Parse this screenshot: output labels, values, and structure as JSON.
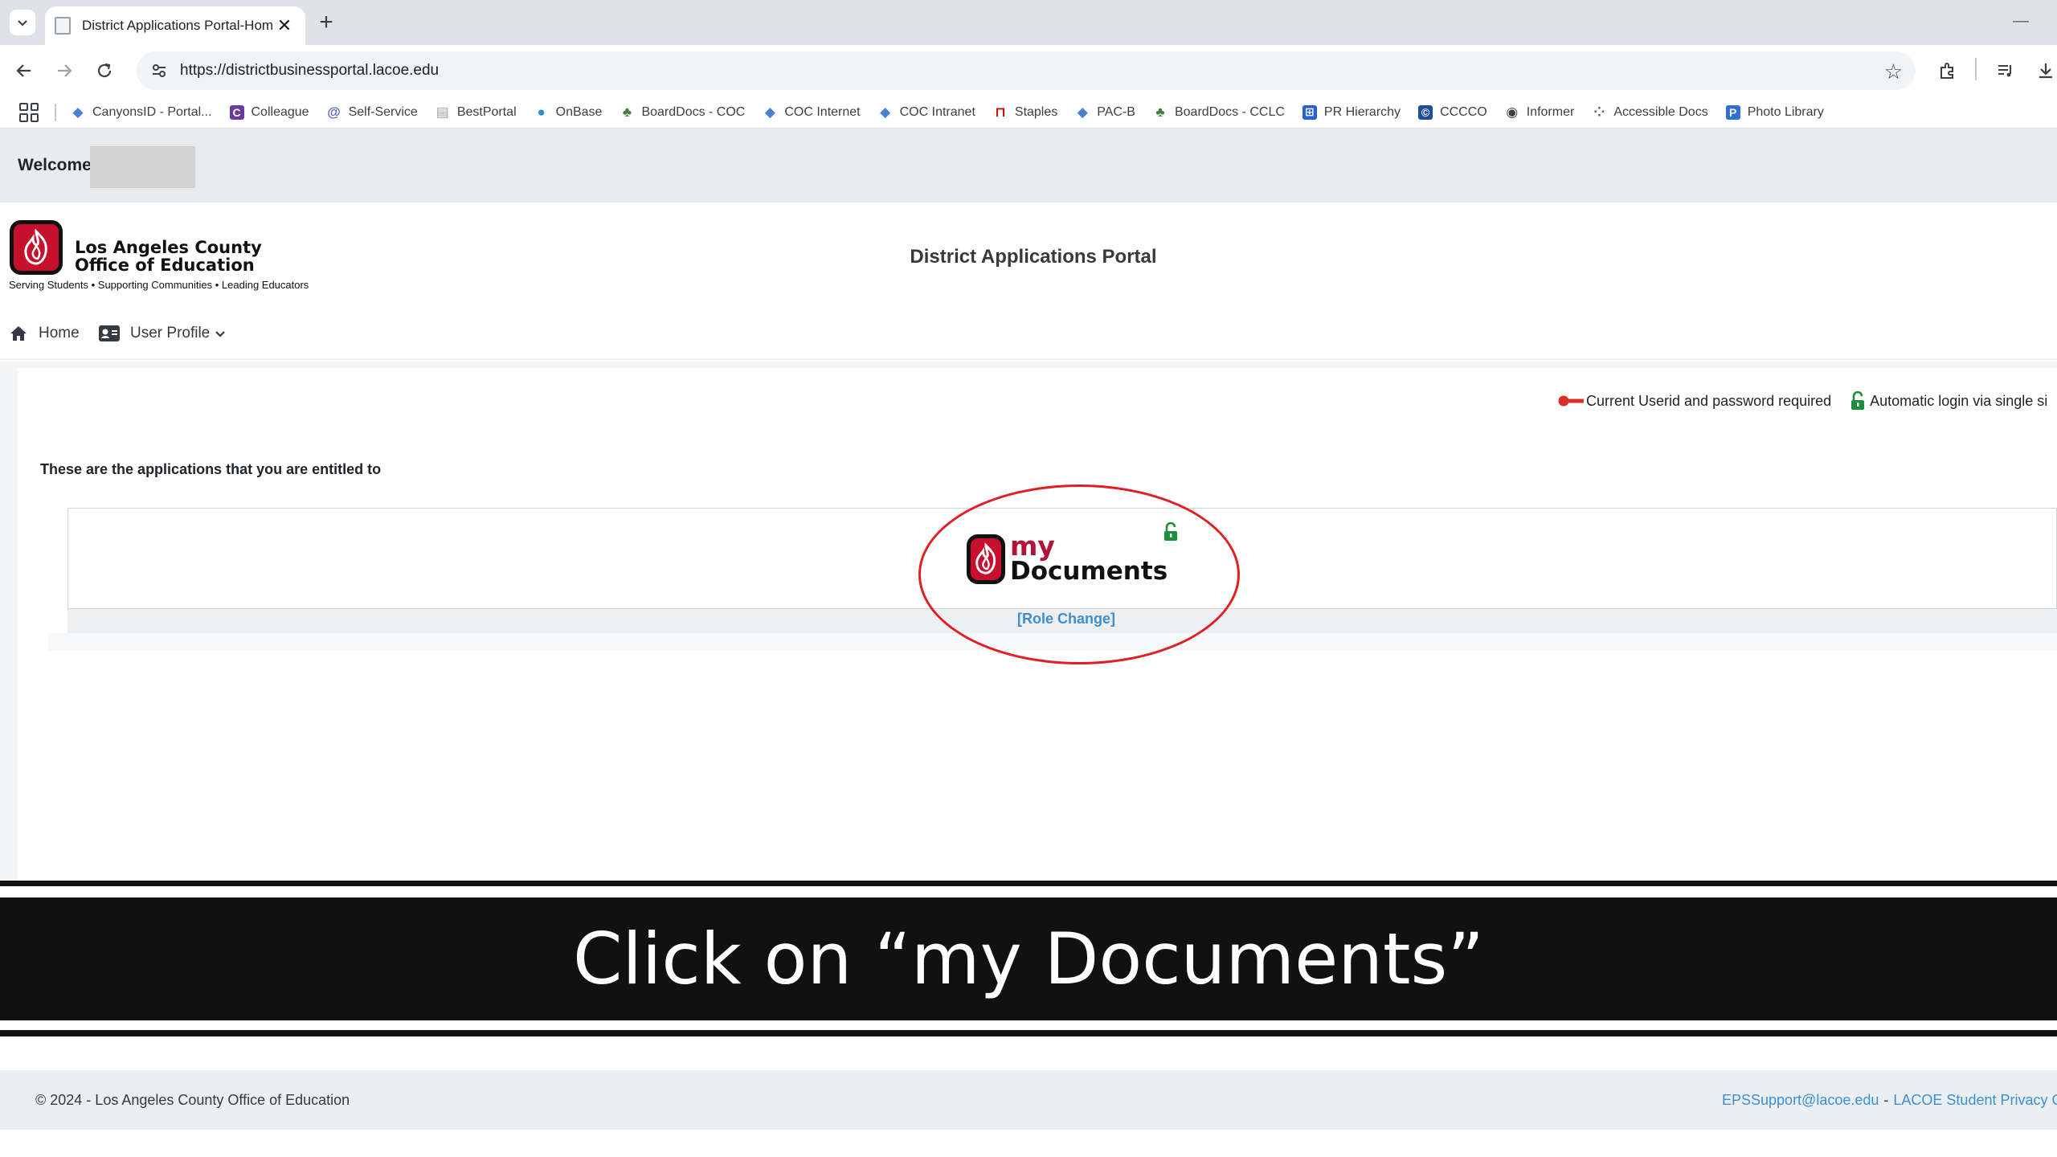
{
  "browser": {
    "tab_title": "District Applications Portal-Home",
    "tab_close": "✕",
    "new_tab": "+",
    "url": "https://districtbusinessportal.lacoe.edu",
    "bookmarks": [
      {
        "label": "CanyonsID - Portal...",
        "icon": "diamond-icon",
        "color": "#4a7fd6"
      },
      {
        "label": "Colleague",
        "icon": "colleague-icon",
        "color": "#6a3aa0"
      },
      {
        "label": "Self-Service",
        "icon": "self-service-icon",
        "color": "#5b5fc7"
      },
      {
        "label": "BestPortal",
        "icon": "page-icon",
        "color": "#9aa0a6"
      },
      {
        "label": "OnBase",
        "icon": "globe-icon",
        "color": "#2f8fcf"
      },
      {
        "label": "BoardDocs - COC",
        "icon": "tree-icon",
        "color": "#3f7d3a"
      },
      {
        "label": "COC Internet",
        "icon": "diamond-icon",
        "color": "#4a7fd6"
      },
      {
        "label": "COC Intranet",
        "icon": "diamond-icon",
        "color": "#4a7fd6"
      },
      {
        "label": "Staples",
        "icon": "staples-icon",
        "color": "#cc0000"
      },
      {
        "label": "PAC-B",
        "icon": "diamond-icon",
        "color": "#4a7fd6"
      },
      {
        "label": "BoardDocs - CCLC",
        "icon": "tree-icon",
        "color": "#3f7d3a"
      },
      {
        "label": "PR Hierarchy",
        "icon": "hierarchy-icon",
        "color": "#2b5fd9"
      },
      {
        "label": "CCCCO",
        "icon": "cccco-icon",
        "color": "#1f4e9a"
      },
      {
        "label": "Informer",
        "icon": "informer-icon",
        "color": "#3c4043"
      },
      {
        "label": "Accessible Docs",
        "icon": "accessible-icon",
        "color": "#5f6368"
      },
      {
        "label": "Photo Library",
        "icon": "photo-icon",
        "color": "#2f6fd6"
      }
    ]
  },
  "page": {
    "welcome_label": "Welcome",
    "org_name_line1": "Los Angeles County",
    "org_name_line2": "Office of Education",
    "org_tagline": "Serving Students • Supporting Communities • Leading Educators",
    "portal_title": "District Applications Portal",
    "nav": {
      "home": "Home",
      "user_profile": "User Profile"
    },
    "legend": {
      "password_required": "Current Userid and password required",
      "single_sign_on": "Automatic login via single si"
    },
    "entitled_heading": "These are the applications that you are entitled to",
    "app": {
      "name_my": "my",
      "name_documents": "Documents",
      "role_change": "[Role Change]"
    },
    "footer": {
      "copyright": "© 2024 - Los Angeles County Office of Education",
      "support_email": "EPSSupport@lacoe.edu",
      "separator": "-",
      "privacy_link": "LACOE Student Privacy G"
    }
  },
  "caption": {
    "text": "Click on “my Documents”"
  },
  "colors": {
    "brand_red": "#c8102e",
    "link_blue": "#3b8fd4",
    "highlight_red": "#e02020",
    "unlock_green": "#1e8e3e",
    "key_red": "#d93025"
  }
}
